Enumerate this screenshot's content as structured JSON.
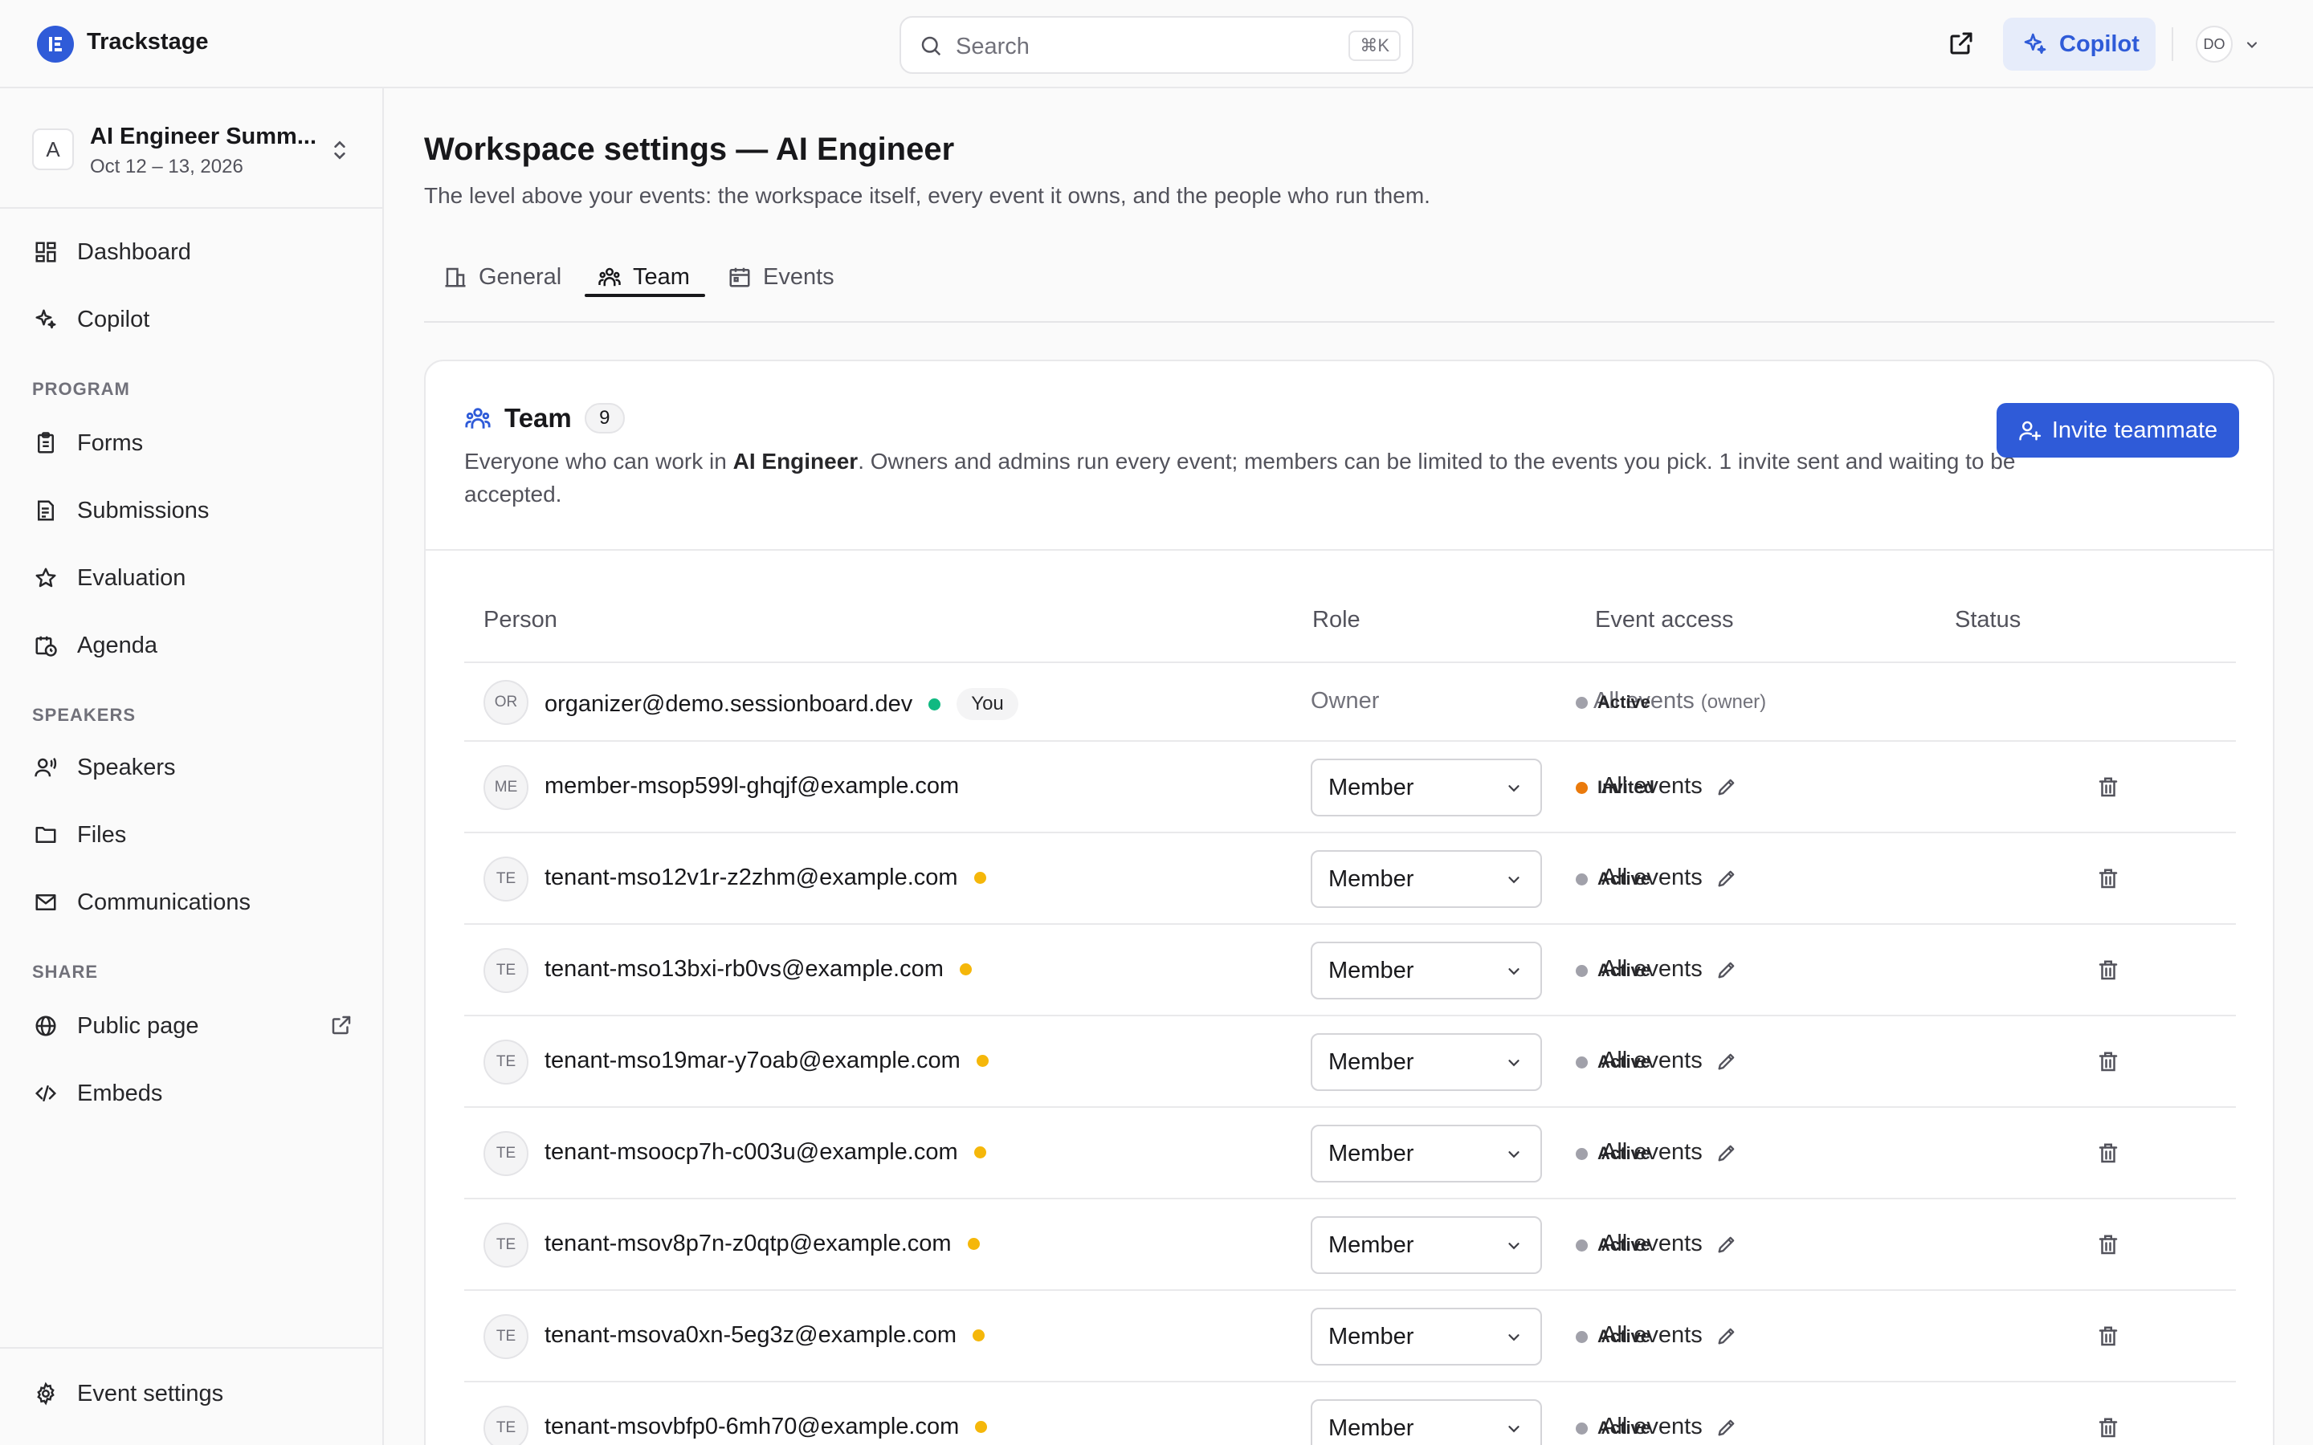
{
  "app": {
    "brand": "Trackstage"
  },
  "search": {
    "placeholder": "Search",
    "shortcut": "⌘K"
  },
  "header": {
    "copilot_label": "Copilot",
    "user_initials": "DO"
  },
  "event_switcher": {
    "initial": "A",
    "name": "AI Engineer Summ...",
    "dates": "Oct 12 – 13, 2026"
  },
  "sidebar": {
    "top": [
      {
        "label": "Dashboard",
        "icon": "dashboard-icon"
      },
      {
        "label": "Copilot",
        "icon": "sparkles-icon"
      }
    ],
    "program_label": "PROGRAM",
    "program": [
      {
        "label": "Forms",
        "icon": "clipboard-icon"
      },
      {
        "label": "Submissions",
        "icon": "file-list-icon"
      },
      {
        "label": "Evaluation",
        "icon": "star-icon"
      },
      {
        "label": "Agenda",
        "icon": "calendar-clock-icon"
      }
    ],
    "speakers_label": "SPEAKERS",
    "speakers": [
      {
        "label": "Speakers",
        "icon": "speaker-icon"
      },
      {
        "label": "Files",
        "icon": "folder-icon"
      },
      {
        "label": "Communications",
        "icon": "mail-icon"
      }
    ],
    "share_label": "SHARE",
    "share": [
      {
        "label": "Public page",
        "icon": "globe-icon"
      },
      {
        "label": "Embeds",
        "icon": "code-icon"
      }
    ],
    "bottom": {
      "label": "Event settings",
      "icon": "gear-icon"
    }
  },
  "page": {
    "title": "Workspace settings — AI Engineer",
    "subtitle": "The level above your events: the workspace itself, every event it owns, and the people who run them."
  },
  "tabs": [
    {
      "label": "General",
      "active": false
    },
    {
      "label": "Team",
      "active": true
    },
    {
      "label": "Events",
      "active": false
    }
  ],
  "team": {
    "title": "Team",
    "count": "9",
    "desc_before": "Everyone who can work in ",
    "desc_workspace": "AI Engineer",
    "desc_after": ". Owners and admins run every event; members can be limited to the events you pick. 1 invite sent and waiting to be accepted.",
    "invite_label": "Invite teammate"
  },
  "table": {
    "headers": {
      "person": "Person",
      "role": "Role",
      "access": "Event access",
      "status": "Status"
    },
    "rows": [
      {
        "initials": "OR",
        "email": "organizer@demo.sessionboard.dev",
        "dot": "#10b981",
        "you": "You",
        "role": "Owner",
        "access": "All events",
        "access_note": "(owner)",
        "status": "Active",
        "status_color": "#a1a1aa"
      },
      {
        "initials": "ME",
        "email": "member-msop599l-ghqjf@example.com",
        "dot": "",
        "role": "Member",
        "access": "All events",
        "status": "Invited",
        "status_color": "#ea7a0c"
      },
      {
        "initials": "TE",
        "email": "tenant-mso12v1r-z2zhm@example.com",
        "dot": "#f5b70a",
        "role": "Member",
        "access": "All events",
        "status": "Active",
        "status_color": "#a1a1aa"
      },
      {
        "initials": "TE",
        "email": "tenant-mso13bxi-rb0vs@example.com",
        "dot": "#f5b70a",
        "role": "Member",
        "access": "All events",
        "status": "Active",
        "status_color": "#a1a1aa"
      },
      {
        "initials": "TE",
        "email": "tenant-mso19mar-y7oab@example.com",
        "dot": "#f5b70a",
        "role": "Member",
        "access": "All events",
        "status": "Active",
        "status_color": "#a1a1aa"
      },
      {
        "initials": "TE",
        "email": "tenant-msoocp7h-c003u@example.com",
        "dot": "#f5b70a",
        "role": "Member",
        "access": "All events",
        "status": "Active",
        "status_color": "#a1a1aa"
      },
      {
        "initials": "TE",
        "email": "tenant-msov8p7n-z0qtp@example.com",
        "dot": "#f5b70a",
        "role": "Member",
        "access": "All events",
        "status": "Active",
        "status_color": "#a1a1aa"
      },
      {
        "initials": "TE",
        "email": "tenant-msova0xn-5eg3z@example.com",
        "dot": "#f5b70a",
        "role": "Member",
        "access": "All events",
        "status": "Active",
        "status_color": "#a1a1aa"
      },
      {
        "initials": "TE",
        "email": "tenant-msovbfp0-6mh70@example.com",
        "dot": "#f5b70a",
        "role": "Member",
        "access": "All events",
        "status": "Active",
        "status_color": "#a1a1aa"
      }
    ]
  },
  "colors": {
    "accent": "#2f5bd8",
    "accent_soft": "#e6ecfa"
  }
}
